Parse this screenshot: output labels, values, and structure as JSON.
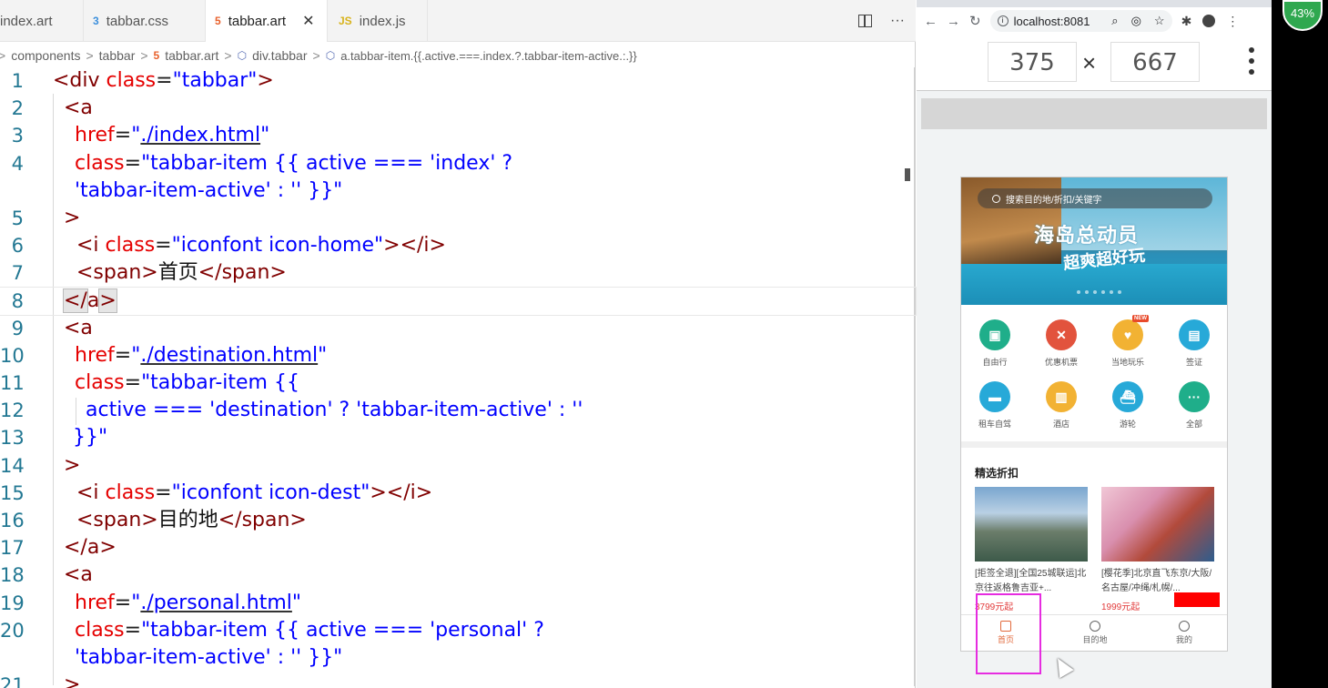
{
  "editor": {
    "tabs": [
      {
        "label": "index.art",
        "icon": "",
        "active": false
      },
      {
        "label": "tabbar.css",
        "icon": "css-file-icon",
        "active": false
      },
      {
        "label": "tabbar.art",
        "icon": "html-file-icon",
        "active": true
      },
      {
        "label": "index.js",
        "icon": "js-file-icon",
        "active": false
      }
    ],
    "tab_icon_text": {
      "css": "3",
      "html": "5",
      "js": "JS"
    },
    "close_glyph": "✕",
    "more_glyph": "···",
    "breadcrumb": [
      "components",
      "tabbar",
      "tabbar.art",
      "div.tabbar",
      "a.tabbar-item.{{.active.===.index.?.tabbar-item-active.:.}}"
    ],
    "lines": [
      {
        "n": "1"
      },
      {
        "n": "2"
      },
      {
        "n": "3"
      },
      {
        "n": "4"
      },
      {
        "n": ""
      },
      {
        "n": "5"
      },
      {
        "n": "6"
      },
      {
        "n": "7"
      },
      {
        "n": "8"
      },
      {
        "n": "9"
      },
      {
        "n": "10"
      },
      {
        "n": "11"
      },
      {
        "n": "12"
      },
      {
        "n": "13"
      },
      {
        "n": "14"
      },
      {
        "n": "15"
      },
      {
        "n": "16"
      },
      {
        "n": "17"
      },
      {
        "n": "18"
      },
      {
        "n": "19"
      },
      {
        "n": "20"
      },
      {
        "n": ""
      },
      {
        "n": "21"
      }
    ],
    "code": {
      "l1_open": "<div ",
      "l1_attr": "class",
      "l1_eq": "=",
      "l1_val": "\"tabbar\"",
      "l1_close": ">",
      "a_open": "<a",
      "href": "href",
      "eq": "=",
      "q": "\"",
      "url_index": "./index.html",
      "url_dest": "./destination.html",
      "url_personal": "./personal.html",
      "class": "class",
      "cls_index": "\"tabbar-item {{ active === 'index' ?",
      "cls_index2": "'tabbar-item-active' : '' }}\"",
      "gt": ">",
      "i_open": "<i ",
      "i_val_home": "\"iconfont icon-home\"",
      "i_close": "></i>",
      "span_open": "<span>",
      "span_close": "</span>",
      "home_cn": "首页",
      "dest_cn": "目的地",
      "a_close_lt": "</",
      "a_close_a": "a",
      "a_close_gt": ">",
      "cls_dest1": "\"tabbar-item {{",
      "cls_dest2": "active === 'destination' ? 'tabbar-item-active' : ''",
      "cls_dest3": "}}\"",
      "i_val_dest": "\"iconfont icon-dest\"",
      "a_close": "</a>",
      "cls_personal": "\"tabbar-item {{ active === 'personal' ?",
      "cls_personal2": "'tabbar-item-active' : '' }}\"",
      "l21": ">"
    }
  },
  "browser": {
    "url": "localhost:8081",
    "width": "375",
    "times": "×",
    "height": "667",
    "phone": {
      "search_placeholder": "搜索目的地/折扣/关键字",
      "banner_title": "海岛总动员",
      "banner_sub": "超爽超好玩",
      "icons": [
        {
          "label": "自由行",
          "color": "#1fae8a",
          "glyph": "▣"
        },
        {
          "label": "优惠机票",
          "color": "#e2533d",
          "glyph": "✕"
        },
        {
          "label": "当地玩乐",
          "color": "#f2b233",
          "glyph": "♥",
          "badge": "NEW"
        },
        {
          "label": "签证",
          "color": "#27a9d8",
          "glyph": "▤"
        },
        {
          "label": "租车自驾",
          "color": "#27a9d8",
          "glyph": "▬"
        },
        {
          "label": "酒店",
          "color": "#f2b233",
          "glyph": "▥"
        },
        {
          "label": "游轮",
          "color": "#27a9d8",
          "glyph": "⛴"
        },
        {
          "label": "全部",
          "color": "#1fae8a",
          "glyph": "···"
        }
      ],
      "section_title": "精选折扣",
      "cards": [
        {
          "title": "[拒签全退][全国25城联运]北京往返格鲁吉亚+...",
          "price": "3799元起"
        },
        {
          "title": "[樱花季]北京直飞东京/大阪/名古屋/冲绳/札幌/...",
          "price": "1999元起"
        }
      ],
      "tabbar": [
        {
          "label": "首页",
          "active": true
        },
        {
          "label": "目的地",
          "active": false
        },
        {
          "label": "我的",
          "active": false
        }
      ]
    }
  },
  "overlay": {
    "percent": "43%"
  }
}
